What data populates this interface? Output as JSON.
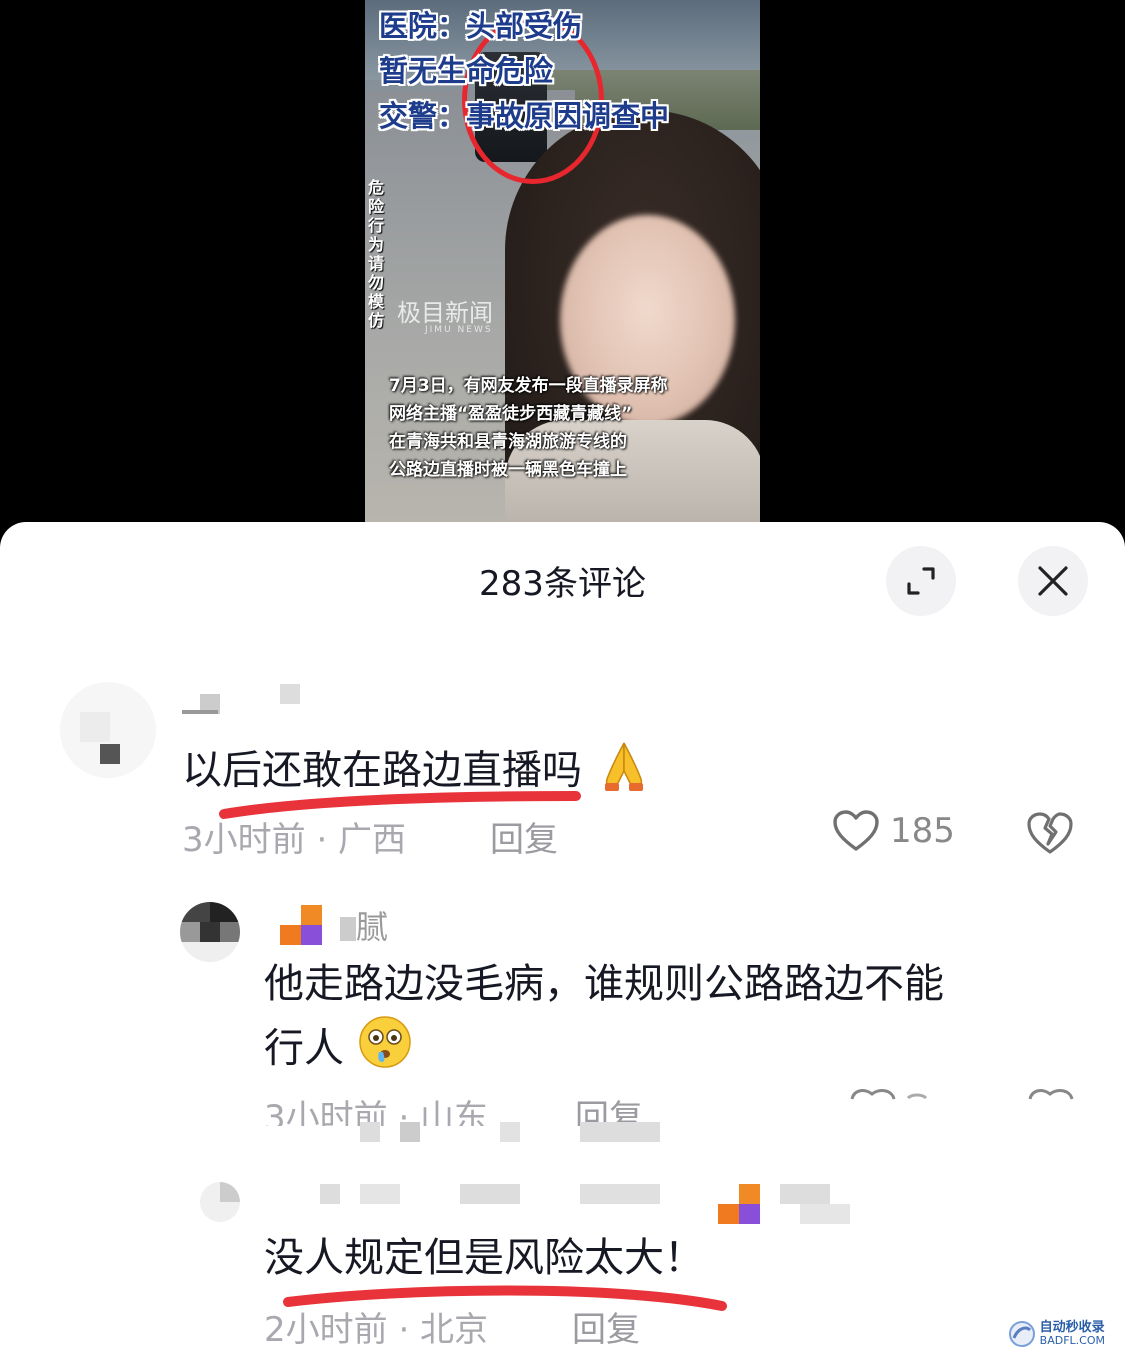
{
  "video": {
    "headline": [
      "医院：头部受伤",
      "暂无生命危险",
      "交警：事故原因调查中"
    ],
    "warning": "危险行为 请勿模仿",
    "watermark": "极目新闻",
    "watermark_sub": "JIMU NEWS",
    "caption": [
      "7月3日，有网友发布一段直播录屏称",
      "网络主播“盈盈徒步西藏青藏线”",
      "在青海共和县青海湖旅游专线的",
      "公路边直播时被一辆黑色车撞上"
    ]
  },
  "sheet": {
    "title": "283条评论",
    "expand_icon": "expand-icon",
    "close_icon": "close-icon"
  },
  "comments": [
    {
      "text": "以后还敢在路边直播吗",
      "emoji": "folded-hands",
      "meta": "3小时前 · 广西",
      "reply_label": "回复",
      "likes": "185",
      "underline_color": "#e8333a"
    },
    {
      "username": "腻",
      "text_line1": "他走路边没毛病，谁规则公路路边不能",
      "text_line2": "行人",
      "emoji": "crying-face",
      "meta": "3小时前 · 山东",
      "reply_label": "回复"
    },
    {
      "text": "没人规定但是风险太大！",
      "meta": "2小时前 · 北京",
      "reply_label": "回复",
      "underline_color": "#e8333a"
    }
  ],
  "site_mark": {
    "line1": "自动秒收录",
    "line2": "BADFL.COM"
  }
}
